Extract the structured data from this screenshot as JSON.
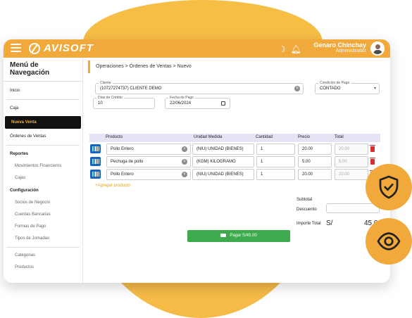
{
  "brand": {
    "name": "AVISOFT"
  },
  "user": {
    "name": "Genaro Chinchay",
    "role": "Administrador"
  },
  "sidebar": {
    "title": "Menú de Navegación",
    "items": [
      {
        "label": "Inicio"
      },
      {
        "label": "Caja"
      },
      {
        "label": "Nueva Venta"
      },
      {
        "label": "Órdenes de Ventas"
      },
      {
        "label": "Reportes"
      },
      {
        "label": "Movimientos Financieros"
      },
      {
        "label": "Cajas"
      },
      {
        "label": "Configuración"
      },
      {
        "label": "Socios de Negocio"
      },
      {
        "label": "Cuentas Bancarias"
      },
      {
        "label": "Formas de Pago"
      },
      {
        "label": "Tipos de Jornadas"
      },
      {
        "label": "Categorias"
      },
      {
        "label": "Productos"
      }
    ]
  },
  "breadcrumb": "Operaciones > Órdenes de Ventas > Nuevo",
  "form": {
    "client": {
      "label": "Cliente",
      "value": "(10727274737) CLIENTE DEMO"
    },
    "payment_condition": {
      "label": "Condición de Pago",
      "value": "CONTADO"
    },
    "credit_days": {
      "label": "Días de Crédito",
      "value": "10"
    },
    "payment_date": {
      "label": "Fecha de Pago",
      "value": "22/06/2024"
    }
  },
  "table": {
    "headers": [
      "Producto",
      "Unidad Medida",
      "Cantidad",
      "Precio",
      "Total"
    ],
    "rows": [
      {
        "product": "Pollo Entero",
        "unit": "(NIU) UNIDAD (BIENES)",
        "qty": "1",
        "price": "20.00",
        "total": "20.00"
      },
      {
        "product": "Pechuga de pollo",
        "unit": "(KGM) KILOGRAMO",
        "qty": "1",
        "price": "5.00",
        "total": "5.00"
      },
      {
        "product": "Pollo Entero",
        "unit": "(NIU) UNIDAD (BIENES)",
        "qty": "1",
        "price": "20.00",
        "total": "20.00"
      }
    ]
  },
  "add_product": "+Agregar producto",
  "totals": {
    "subtotal_label": "Subtotal",
    "discount_label": "Descuento",
    "total_label": "Importe Total",
    "currency": "S/",
    "total_value": "45.00"
  },
  "pay_button": "Pagar S/45.00",
  "colors": {
    "accent": "#F2A93B",
    "pay": "#3DAA4D",
    "barcode": "#1565C0",
    "delete": "#D32F2F"
  },
  "icons": [
    "menu-icon",
    "moon-icon",
    "bell-icon",
    "shield-check-icon",
    "eye-icon",
    "barcode-icon",
    "trash-icon",
    "calendar-icon"
  ]
}
